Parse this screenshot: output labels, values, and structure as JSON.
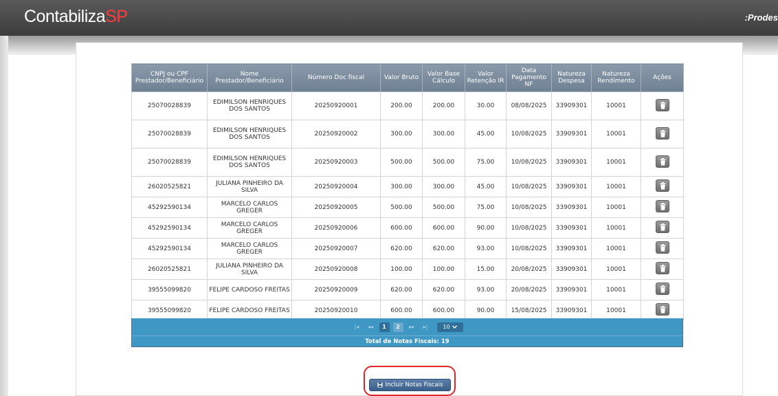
{
  "header": {
    "logo_main": "Contabiliza",
    "logo_accent": "SP",
    "brand_right": ":Prodes"
  },
  "table": {
    "columns": [
      "CNPJ ou CPF Prestador/Beneficiário",
      "Nome Prestador/Beneficiário",
      "Número Doc fiscal",
      "Valor Bruto",
      "Valor Base Cálculo",
      "Valor Retenção IR",
      "Data Pagamento NF",
      "Natureza Despesa",
      "Natureza Rendimento",
      "Ações"
    ],
    "rows": [
      [
        "25070028839",
        "EDIMILSON HENRIQUES DOS SANTOS",
        "20250920001",
        "200.00",
        "200.00",
        "30.00",
        "08/08/2025",
        "33909301",
        "10001"
      ],
      [
        "25070028839",
        "EDIMILSON HENRIQUES DOS SANTOS",
        "20250920002",
        "300.00",
        "300.00",
        "45.00",
        "10/08/2025",
        "33909301",
        "10001"
      ],
      [
        "25070028839",
        "EDIMILSON HENRIQUES DOS SANTOS",
        "20250920003",
        "500.00",
        "500.00",
        "75.00",
        "10/08/2025",
        "33909301",
        "10001"
      ],
      [
        "26020525821",
        "JULIANA PINHEIRO DA SILVA",
        "20250920004",
        "300.00",
        "300.00",
        "45.00",
        "10/08/2025",
        "33909301",
        "10001"
      ],
      [
        "45292590134",
        "MARCELO CARLOS GREGER",
        "20250920005",
        "500.00",
        "500.00",
        "75.00",
        "10/08/2025",
        "33909301",
        "10001"
      ],
      [
        "45292590134",
        "MARCELO CARLOS GREGER",
        "20250920006",
        "600.00",
        "600.00",
        "90.00",
        "10/08/2025",
        "33909301",
        "10001"
      ],
      [
        "45292590134",
        "MARCELO CARLOS GREGER",
        "20250920007",
        "620.00",
        "620.00",
        "93.00",
        "10/08/2025",
        "33909301",
        "10001"
      ],
      [
        "26020525821",
        "JULIANA PINHEIRO DA SILVA",
        "20250920008",
        "100.00",
        "100.00",
        "15.00",
        "20/08/2025",
        "33909301",
        "10001"
      ],
      [
        "39555099820",
        "FELIPE CARDOSO FREITAS",
        "20250920009",
        "620.00",
        "620.00",
        "93.00",
        "20/08/2025",
        "33909301",
        "10001"
      ],
      [
        "39555099820",
        "FELIPE CARDOSO FREITAS",
        "20250920010",
        "600.00",
        "600.00",
        "90.00",
        "15/08/2025",
        "33909301",
        "10001"
      ]
    ],
    "delete_icon": "trash-icon"
  },
  "pager": {
    "first": "|◂",
    "prev": "◂◂",
    "pages": [
      "1",
      "2"
    ],
    "current_page": "1",
    "next": "▸▸",
    "last": "▸|",
    "page_size": "10",
    "total_label": "Total de Notas Fiscais: 19"
  },
  "actions": {
    "include_label": "Incluir Notas Fiscais",
    "include_icon": "save-icon"
  },
  "colors": {
    "header_bg": "#3c3c3c",
    "logo_accent": "#ff3c3c",
    "table_header": "#7b8c9e",
    "pager_bg": "#3f97c4",
    "button_bg": "#3a5f8a",
    "highlight": "#e0252b"
  }
}
